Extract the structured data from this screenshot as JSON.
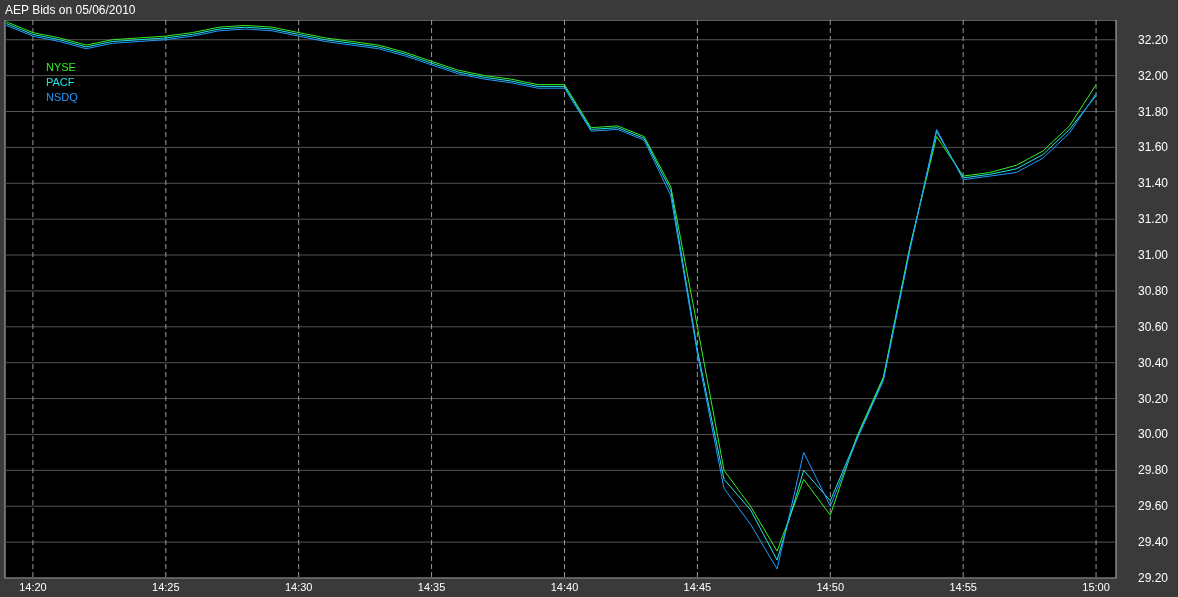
{
  "window": {
    "title": "AEP Bids on 05/06/2010"
  },
  "chart": {
    "chart_data": {
      "type": "line",
      "categories": [
        null,
        "14:20",
        null,
        null,
        null,
        null,
        "14:25",
        null,
        null,
        null,
        null,
        "14:30",
        null,
        null,
        null,
        null,
        "14:35",
        null,
        null,
        null,
        null,
        "14:40",
        null,
        null,
        null,
        null,
        "14:45",
        null,
        null,
        null,
        null,
        "14:50",
        null,
        null,
        null,
        null,
        "14:55",
        null,
        null,
        null,
        null,
        "15:00"
      ],
      "series": [
        {
          "name": "NYSE",
          "color": "#33ee22",
          "values": [
            32.3,
            32.24,
            32.21,
            32.17,
            32.2,
            32.21,
            32.22,
            32.24,
            32.27,
            32.28,
            32.27,
            32.24,
            32.21,
            32.19,
            32.17,
            32.13,
            32.08,
            32.03,
            32.0,
            31.98,
            31.95,
            31.95,
            31.71,
            31.72,
            31.66,
            31.38,
            30.6,
            29.8,
            29.6,
            29.35,
            29.75,
            29.55,
            29.99,
            30.32,
            31.05,
            31.66,
            31.44,
            31.46,
            31.5,
            31.58,
            31.72,
            31.95
          ]
        },
        {
          "name": "PACF",
          "color": "#22e5e5",
          "values": [
            32.29,
            32.23,
            32.2,
            32.16,
            32.19,
            32.2,
            32.21,
            32.23,
            32.26,
            32.27,
            32.26,
            32.23,
            32.2,
            32.18,
            32.16,
            32.12,
            32.07,
            32.02,
            31.99,
            31.97,
            31.94,
            31.94,
            31.7,
            31.71,
            31.65,
            31.36,
            30.47,
            29.75,
            29.58,
            29.3,
            29.8,
            29.63,
            29.98,
            30.31,
            31.04,
            31.69,
            31.43,
            31.45,
            31.48,
            31.56,
            31.7,
            31.89
          ]
        },
        {
          "name": "NSDQ",
          "color": "#1e9bff",
          "values": [
            32.28,
            32.22,
            32.19,
            32.15,
            32.18,
            32.19,
            32.2,
            32.22,
            32.25,
            32.26,
            32.25,
            32.22,
            32.19,
            32.17,
            32.15,
            32.11,
            32.06,
            32.01,
            31.98,
            31.96,
            31.93,
            31.93,
            31.69,
            31.7,
            31.64,
            31.33,
            30.45,
            29.7,
            29.5,
            29.25,
            29.9,
            29.6,
            29.97,
            30.3,
            31.03,
            31.7,
            31.42,
            31.44,
            31.46,
            31.54,
            31.68,
            31.9
          ]
        }
      ],
      "grid": true,
      "ylim": [
        29.2,
        32.31
      ],
      "yticks": [
        {
          "value": 29.2,
          "label": "29.20"
        },
        {
          "value": 29.4,
          "label": "29.40"
        },
        {
          "value": 29.6,
          "label": "29.60"
        },
        {
          "value": 29.8,
          "label": "29.80"
        },
        {
          "value": 30,
          "label": "30.00"
        },
        {
          "value": 30.2,
          "label": "30.20"
        },
        {
          "value": 30.4,
          "label": "30.40"
        },
        {
          "value": 30.6,
          "label": "30.60"
        },
        {
          "value": 30.8,
          "label": "30.80"
        },
        {
          "value": 31,
          "label": "31.00"
        },
        {
          "value": 31.2,
          "label": "31.20"
        },
        {
          "value": 31.4,
          "label": "31.40"
        },
        {
          "value": 31.6,
          "label": "31.60"
        },
        {
          "value": 31.8,
          "label": "31.80"
        },
        {
          "value": 32,
          "label": "32.00"
        },
        {
          "value": 32.2,
          "label": "32.20"
        }
      ]
    }
  }
}
